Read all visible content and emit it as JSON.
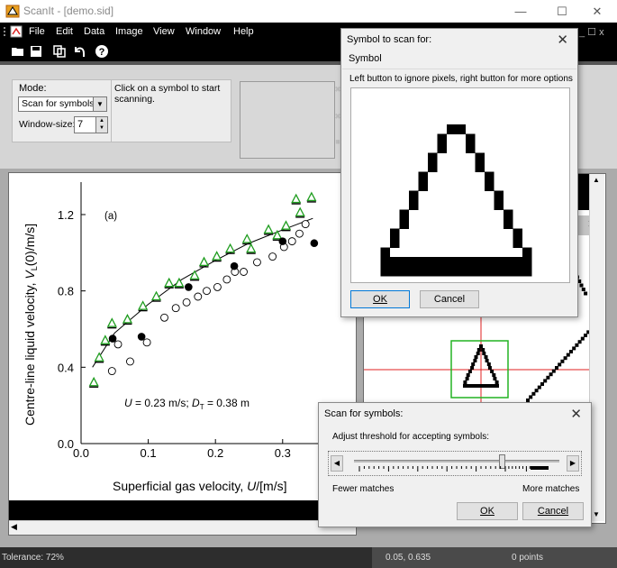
{
  "window": {
    "title": "ScanIt - [demo.sid]",
    "min_glyph": "—",
    "max_glyph": "☐",
    "close_glyph": "✕"
  },
  "menu": {
    "items": [
      "File",
      "Edit",
      "Data",
      "Image",
      "View",
      "Window",
      "Help"
    ],
    "mdi_controls": "_ ☐ x"
  },
  "toolbar": {
    "icons": [
      "open-icon",
      "save-icon",
      "copy-icon",
      "undo-icon",
      "help-icon"
    ]
  },
  "panel": {
    "mode_label": "Mode:",
    "mode_value": "Scan for symbols",
    "window_size_label": "Window-size:",
    "window_size_value": "7",
    "hint": "Click on a symbol to start scanning."
  },
  "plot": {
    "panel_label": "(a)",
    "annotation": {
      "u_sym": "U",
      "u_rest": " = 0.23 m/s;  ",
      "d_sym": "D",
      "d_sub": "T",
      "d_rest": " = 0.38 m"
    },
    "xlabel": {
      "prefix": "Superficial gas velocity, ",
      "sym": "U",
      "suffix": "/[m/s]"
    },
    "ylabel": {
      "prefix": "Centre-line liquid velocity, ",
      "sym": "V",
      "sub": "L",
      "suffix": "(0)/m/s]"
    }
  },
  "chart_data": {
    "type": "scatter",
    "x_ticks": [
      "0.0",
      "0.1",
      "0.2",
      "0.3"
    ],
    "y_ticks": [
      "0.0",
      "0.4",
      "0.8",
      "1.2"
    ],
    "xlim": [
      0,
      0.37
    ],
    "ylim": [
      0,
      1.37
    ],
    "grid": false,
    "series": [
      {
        "marker": "triangle",
        "color": "#1f9d1f",
        "points": [
          [
            0.019,
            0.32
          ],
          [
            0.027,
            0.45
          ],
          [
            0.036,
            0.54
          ],
          [
            0.046,
            0.63
          ],
          [
            0.069,
            0.65
          ],
          [
            0.092,
            0.72
          ],
          [
            0.112,
            0.77
          ],
          [
            0.131,
            0.84
          ],
          [
            0.146,
            0.84
          ],
          [
            0.169,
            0.88
          ],
          [
            0.183,
            0.95
          ],
          [
            0.202,
            0.98
          ],
          [
            0.222,
            1.02
          ],
          [
            0.247,
            1.07
          ],
          [
            0.253,
            1.02
          ],
          [
            0.279,
            1.12
          ],
          [
            0.292,
            1.09
          ],
          [
            0.305,
            1.14
          ],
          [
            0.32,
            1.28
          ],
          [
            0.326,
            1.21
          ],
          [
            0.343,
            1.29
          ]
        ]
      },
      {
        "marker": "open-circle",
        "color": "#000000",
        "points": [
          [
            0.046,
            0.38
          ],
          [
            0.055,
            0.52
          ],
          [
            0.073,
            0.43
          ],
          [
            0.098,
            0.53
          ],
          [
            0.124,
            0.66
          ],
          [
            0.141,
            0.71
          ],
          [
            0.157,
            0.74
          ],
          [
            0.174,
            0.77
          ],
          [
            0.187,
            0.8
          ],
          [
            0.203,
            0.82
          ],
          [
            0.217,
            0.86
          ],
          [
            0.229,
            0.9
          ],
          [
            0.242,
            0.9
          ],
          [
            0.262,
            0.95
          ],
          [
            0.285,
            0.98
          ],
          [
            0.302,
            1.03
          ],
          [
            0.314,
            1.06
          ],
          [
            0.325,
            1.1
          ],
          [
            0.334,
            1.15
          ]
        ]
      },
      {
        "marker": "filled-circle",
        "color": "#000000",
        "points": [
          [
            0.047,
            0.55
          ],
          [
            0.09,
            0.56
          ],
          [
            0.16,
            0.82
          ],
          [
            0.228,
            0.93
          ],
          [
            0.3,
            1.06
          ],
          [
            0.347,
            1.05
          ]
        ]
      }
    ],
    "fit_line": [
      [
        0.017,
        0.4
      ],
      [
        0.05,
        0.58
      ],
      [
        0.1,
        0.73
      ],
      [
        0.15,
        0.86
      ],
      [
        0.2,
        0.96
      ],
      [
        0.25,
        1.05
      ],
      [
        0.3,
        1.12
      ],
      [
        0.345,
        1.18
      ]
    ]
  },
  "symbol_dialog": {
    "title": "Symbol to scan for:",
    "subtitle": "Symbol",
    "hint": "Left button to ignore pixels, right button for more options",
    "ok": "OK",
    "cancel": "Cancel"
  },
  "scan_dialog": {
    "title": "Scan for symbols:",
    "label": "Adjust threshold for accepting symbols:",
    "fewer": "Fewer matches",
    "more": "More matches",
    "ok": "OK",
    "cancel": "Cancel",
    "threshold": 0.72
  },
  "status": {
    "tolerance": "Tolerance: 72%",
    "coords": "0.05, 0.635",
    "points": "0 points"
  },
  "colors": {
    "accent": "#0078d7",
    "match_box": "#22b322",
    "crosshair": "#e02020"
  }
}
